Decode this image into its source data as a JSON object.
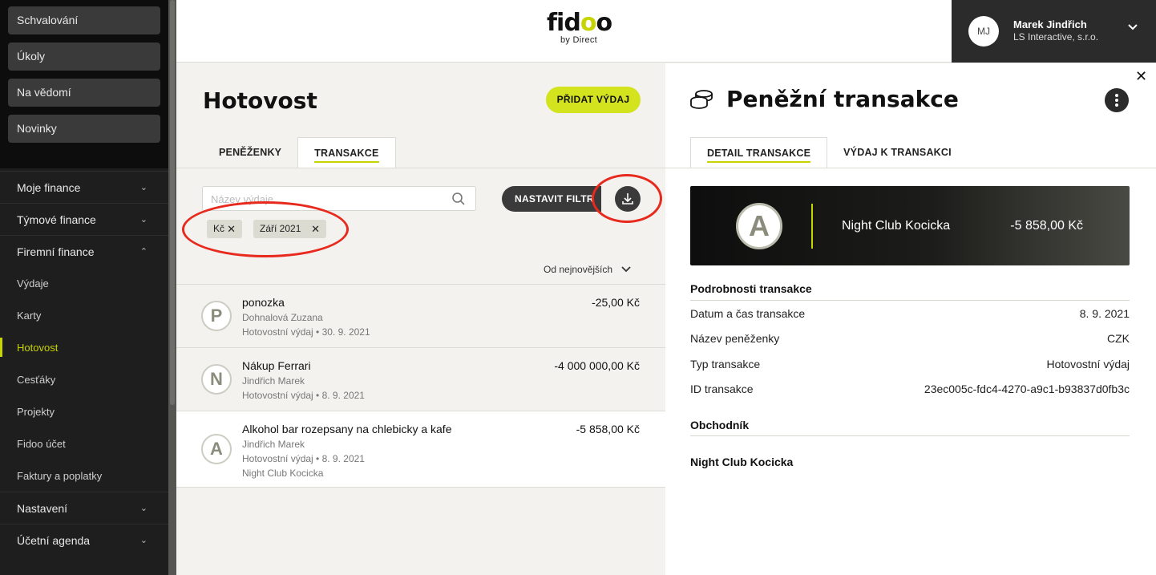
{
  "sidebar": {
    "top_buttons": [
      "Schvalování",
      "Úkoly",
      "Na vědomí",
      "Novinky"
    ],
    "groups": {
      "moje_finance": "Moje finance",
      "tymove_finance": "Týmové finance",
      "firemni_finance": "Firemní finance",
      "nastaveni": "Nastavení",
      "ucetni_agenda": "Účetní agenda"
    },
    "sub_items": [
      "Výdaje",
      "Karty",
      "Hotovost",
      "Cesťáky",
      "Projekty",
      "Fidoo účet",
      "Faktury a poplatky"
    ],
    "active_item": "Hotovost"
  },
  "header": {
    "logo_word_a": "fid",
    "logo_word_b": "o",
    "logo_word_c": "o",
    "logo_sub": "by Direct",
    "user_initials": "MJ",
    "user_name": "Marek Jindřich",
    "user_company": "LS Interactive, s.r.o."
  },
  "left": {
    "title": "Hotovost",
    "add_button": "PŘIDAT VÝDAJ",
    "tabs": [
      "PENĚŽENKY",
      "TRANSAKCE"
    ],
    "active_tab": "TRANSAKCE",
    "search_placeholder": "Název výdaje",
    "filter_button": "NASTAVIT FILTR",
    "chips": [
      "Kč",
      "Září 2021"
    ],
    "sort_label": "Od nejnovějších",
    "transactions": [
      {
        "letter": "P",
        "title": "ponozka",
        "person": "Dohnalová Zuzana",
        "meta": "Hotovostní výdaj • 30. 9. 2021",
        "amount": "-25,00 Kč"
      },
      {
        "letter": "N",
        "title": "Nákup Ferrari",
        "person": "Jindřich Marek",
        "meta": "Hotovostní výdaj • 8. 9. 2021",
        "amount": "-4 000 000,00 Kč"
      },
      {
        "letter": "A",
        "title": "Alkohol bar rozepsany na chlebicky a kafe",
        "person": "Jindřich Marek",
        "meta": "Hotovostní výdaj • 8. 9. 2021",
        "merchant": "Night Club Kocicka",
        "amount": "-5 858,00 Kč"
      }
    ]
  },
  "right": {
    "title": "Peněžní transakce",
    "close_glyph": "✕",
    "tabs": [
      "DETAIL TRANSAKCE",
      "VÝDAJ K TRANSAKCI"
    ],
    "card": {
      "letter": "A",
      "merchant": "Night Club Kocicka",
      "amount": "-5 858,00 Kč"
    },
    "details_heading": "Podrobnosti transakce",
    "details": [
      {
        "label": "Datum a čas transakce",
        "value": "8. 9. 2021"
      },
      {
        "label": "Název peněženky",
        "value": "CZK"
      },
      {
        "label": "Typ transakce",
        "value": "Hotovostní výdaj"
      },
      {
        "label": "ID transakce",
        "value": "23ec005c-fdc4-4270-a9c1-b93837d0fb3c"
      }
    ],
    "merchant_heading": "Obchodník",
    "merchant_name": "Night Club Kocicka"
  },
  "colors": {
    "accent": "#c8d400",
    "button_lime": "#d3e31e",
    "annotation_red": "#e8291d",
    "sidebar_bg": "#1e1e1e"
  },
  "icons": [
    "search-icon",
    "download-icon",
    "coins-icon",
    "more-vertical-icon",
    "close-icon",
    "chevron-down-icon",
    "chevron-up-icon",
    "remove-chip-icon"
  ]
}
